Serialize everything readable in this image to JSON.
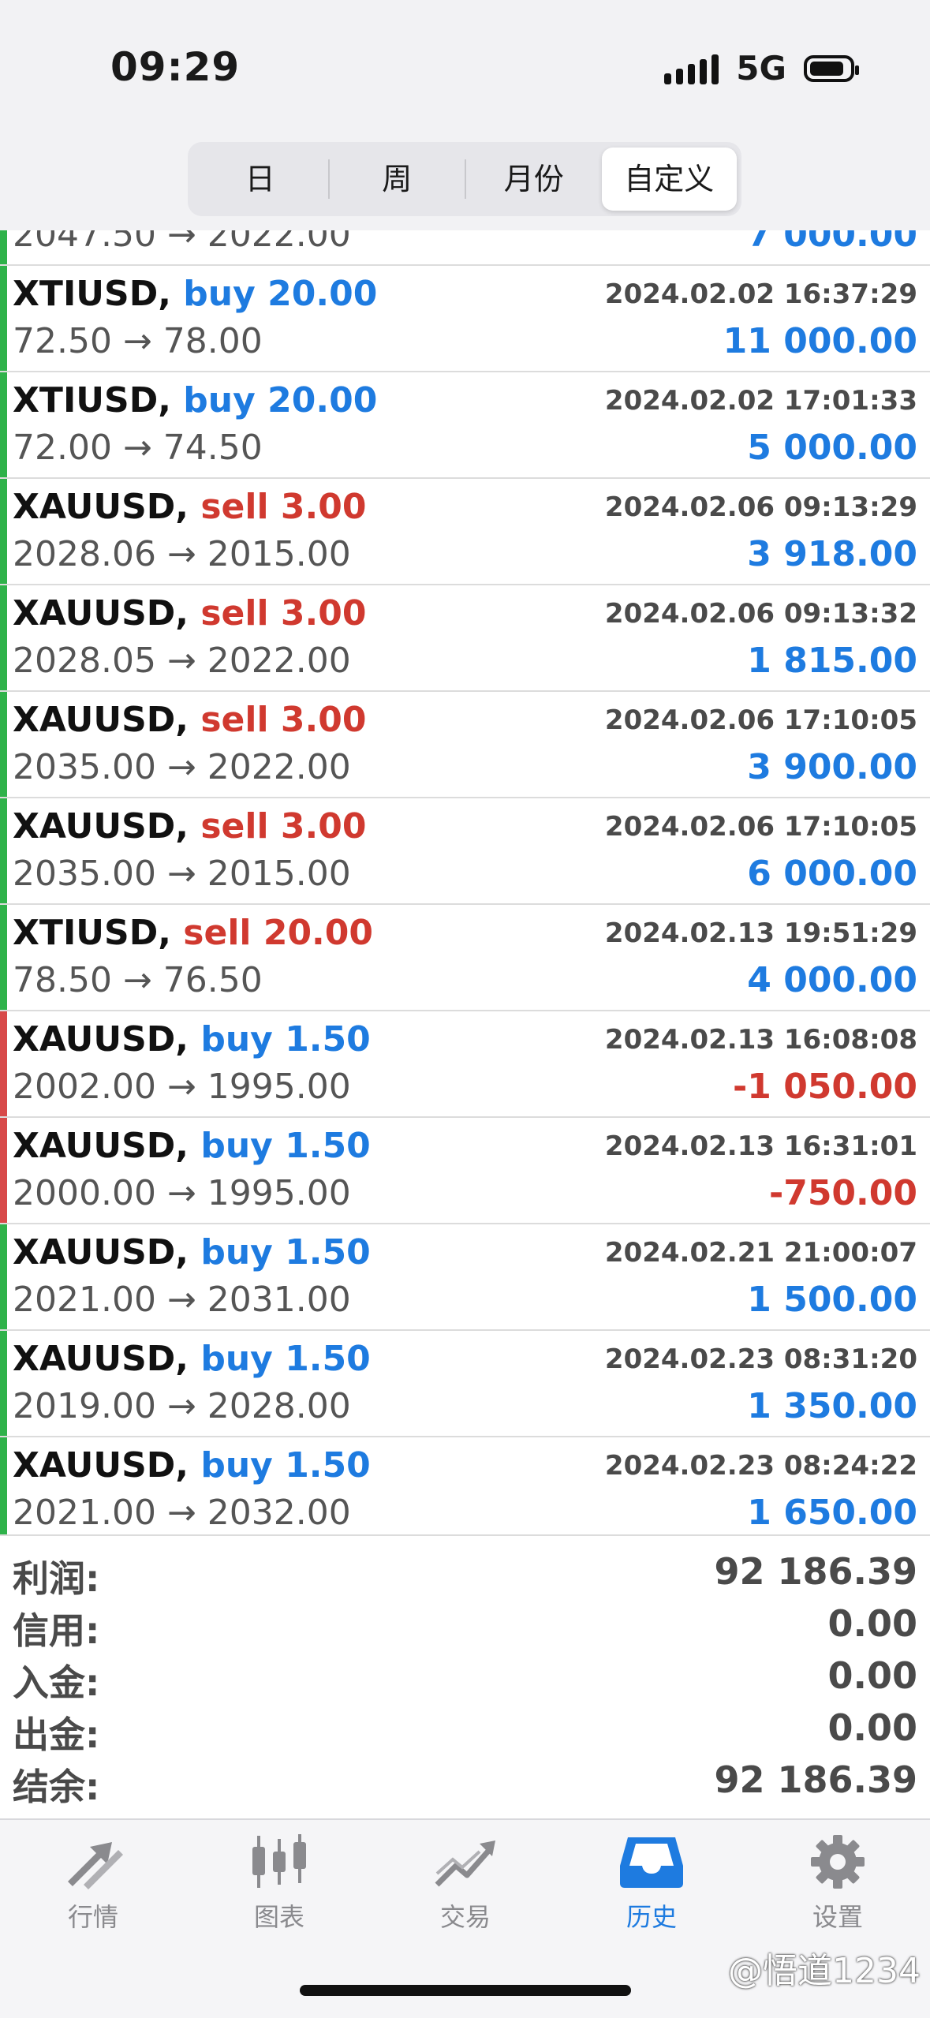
{
  "status_bar": {
    "time": "09:29",
    "network": "5G"
  },
  "period_tabs": [
    "日",
    "周",
    "月份",
    "自定义"
  ],
  "period_active_index": 3,
  "partial_row": {
    "prices": "2047.50 → 2022.00",
    "profit": "7 000.00"
  },
  "trades": [
    {
      "symbol": "XTIUSD,",
      "side": "buy",
      "volume": "20.00",
      "datetime": "2024.02.02 16:37:29",
      "prices": "72.50 → 78.00",
      "profit": "11 000.00",
      "result": "profit"
    },
    {
      "symbol": "XTIUSD,",
      "side": "buy",
      "volume": "20.00",
      "datetime": "2024.02.02 17:01:33",
      "prices": "72.00 → 74.50",
      "profit": "5 000.00",
      "result": "profit"
    },
    {
      "symbol": "XAUUSD,",
      "side": "sell",
      "volume": "3.00",
      "datetime": "2024.02.06 09:13:29",
      "prices": "2028.06 → 2015.00",
      "profit": "3 918.00",
      "result": "profit"
    },
    {
      "symbol": "XAUUSD,",
      "side": "sell",
      "volume": "3.00",
      "datetime": "2024.02.06 09:13:32",
      "prices": "2028.05 → 2022.00",
      "profit": "1 815.00",
      "result": "profit"
    },
    {
      "symbol": "XAUUSD,",
      "side": "sell",
      "volume": "3.00",
      "datetime": "2024.02.06 17:10:05",
      "prices": "2035.00 → 2022.00",
      "profit": "3 900.00",
      "result": "profit"
    },
    {
      "symbol": "XAUUSD,",
      "side": "sell",
      "volume": "3.00",
      "datetime": "2024.02.06 17:10:05",
      "prices": "2035.00 → 2015.00",
      "profit": "6 000.00",
      "result": "profit"
    },
    {
      "symbol": "XTIUSD,",
      "side": "sell",
      "volume": "20.00",
      "datetime": "2024.02.13 19:51:29",
      "prices": "78.50 → 76.50",
      "profit": "4 000.00",
      "result": "profit"
    },
    {
      "symbol": "XAUUSD,",
      "side": "buy",
      "volume": "1.50",
      "datetime": "2024.02.13 16:08:08",
      "prices": "2002.00 → 1995.00",
      "profit": "-1 050.00",
      "result": "loss"
    },
    {
      "symbol": "XAUUSD,",
      "side": "buy",
      "volume": "1.50",
      "datetime": "2024.02.13 16:31:01",
      "prices": "2000.00 → 1995.00",
      "profit": "-750.00",
      "result": "loss"
    },
    {
      "symbol": "XAUUSD,",
      "side": "buy",
      "volume": "1.50",
      "datetime": "2024.02.21 21:00:07",
      "prices": "2021.00 → 2031.00",
      "profit": "1 500.00",
      "result": "profit"
    },
    {
      "symbol": "XAUUSD,",
      "side": "buy",
      "volume": "1.50",
      "datetime": "2024.02.23 08:31:20",
      "prices": "2019.00 → 2028.00",
      "profit": "1 350.00",
      "result": "profit"
    },
    {
      "symbol": "XAUUSD,",
      "side": "buy",
      "volume": "1.50",
      "datetime": "2024.02.23 08:24:22",
      "prices": "2021.00 → 2032.00",
      "profit": "1 650.00",
      "result": "profit"
    }
  ],
  "summary": [
    {
      "label": "利润:",
      "value": "92 186.39"
    },
    {
      "label": "信用:",
      "value": "0.00"
    },
    {
      "label": "入金:",
      "value": "0.00"
    },
    {
      "label": "出金:",
      "value": "0.00"
    },
    {
      "label": "结余:",
      "value": "92 186.39"
    }
  ],
  "tabbar": [
    {
      "label": "行情",
      "icon": "quotes-arrows-icon"
    },
    {
      "label": "图表",
      "icon": "candlestick-chart-icon"
    },
    {
      "label": "交易",
      "icon": "trade-trend-icon"
    },
    {
      "label": "历史",
      "icon": "history-inbox-icon"
    },
    {
      "label": "设置",
      "icon": "gear-icon"
    }
  ],
  "tabbar_active_index": 3,
  "watermark": "@悟道1234",
  "colors": {
    "buy": "#1e7be0",
    "sell": "#d0392f",
    "profit_bar": "#2fb24a",
    "loss_bar": "#d84a4a",
    "active_tab": "#1e7be0"
  }
}
